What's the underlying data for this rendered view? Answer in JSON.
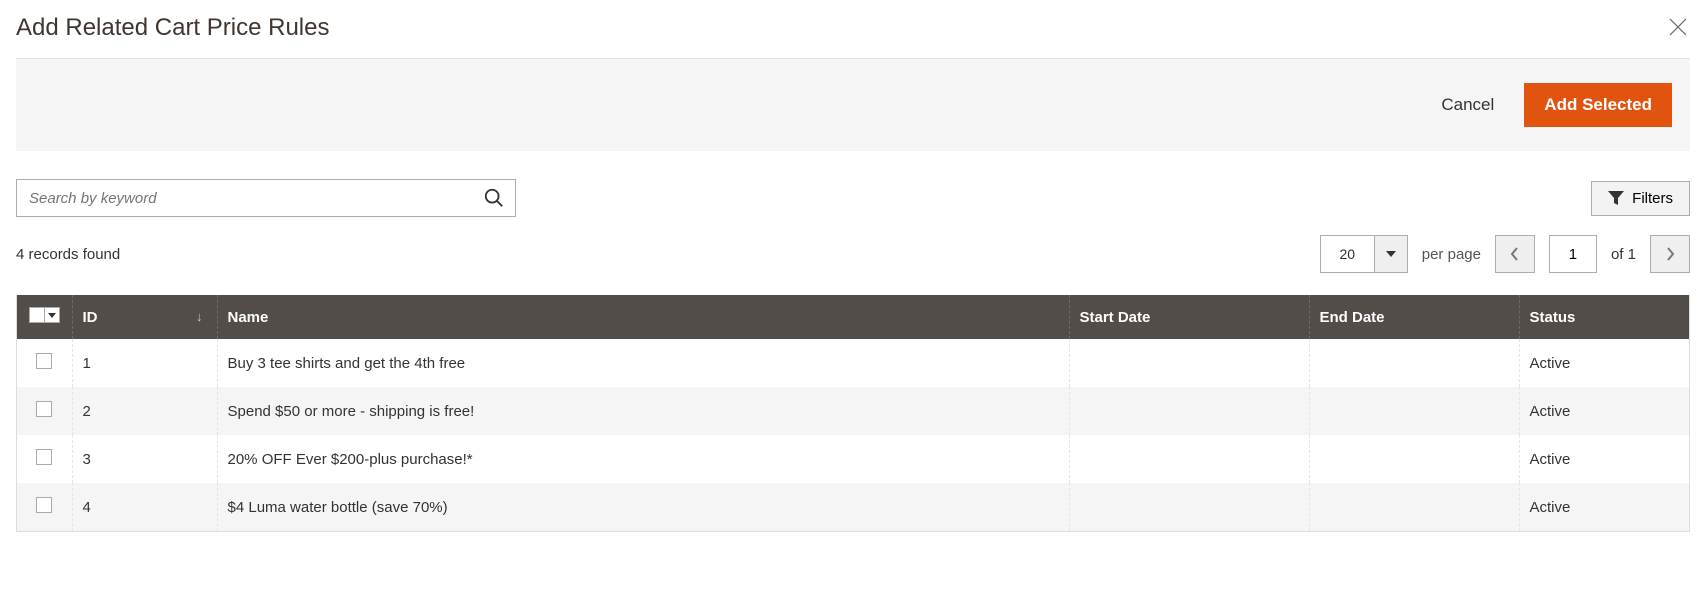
{
  "header": {
    "title": "Add Related Cart Price Rules"
  },
  "actions": {
    "cancel": "Cancel",
    "add_selected": "Add Selected"
  },
  "search": {
    "placeholder": "Search by keyword"
  },
  "filters": {
    "label": "Filters"
  },
  "records_found": "4 records found",
  "pager": {
    "page_size": "20",
    "per_page_label": "per page",
    "current_page": "1",
    "total_pages": "1",
    "of_label": "of"
  },
  "columns": {
    "id": "ID",
    "name": "Name",
    "start_date": "Start Date",
    "end_date": "End Date",
    "status": "Status"
  },
  "rows": [
    {
      "id": "1",
      "name": "Buy 3 tee shirts and get the 4th free",
      "start_date": "",
      "end_date": "",
      "status": "Active"
    },
    {
      "id": "2",
      "name": "Spend $50 or more - shipping is free!",
      "start_date": "",
      "end_date": "",
      "status": "Active"
    },
    {
      "id": "3",
      "name": "20% OFF Ever $200-plus purchase!*",
      "start_date": "",
      "end_date": "",
      "status": "Active"
    },
    {
      "id": "4",
      "name": "$4 Luma water bottle (save 70%)",
      "start_date": "",
      "end_date": "",
      "status": "Active"
    }
  ]
}
